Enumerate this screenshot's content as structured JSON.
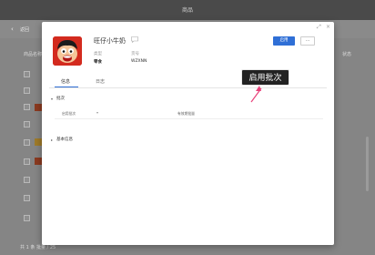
{
  "app": {
    "title": "商品"
  },
  "background": {
    "back_label": "返回",
    "columns": [
      "商品名称",
      "状态"
    ],
    "footer": "共 1 条  批量 / 25"
  },
  "modal": {
    "product": {
      "name": "旺仔小牛奶",
      "type_label": "类型",
      "type_value": "零食",
      "code_label": "货号",
      "code_value": "WZXNN"
    },
    "actions": {
      "enable_label": "启用",
      "more_label": "···"
    },
    "tabs": [
      {
        "label": "信息",
        "active": true
      },
      {
        "label": "日志",
        "active": false
      }
    ],
    "sections": {
      "batch": {
        "title": "批次",
        "field_label": "启用批次",
        "field_selector": "▾",
        "field_value": "有效期批量"
      },
      "basic": {
        "title": "基本信息"
      }
    },
    "window_controls": {
      "expand": "⤢",
      "close": "×"
    }
  },
  "annotation": {
    "text": "启用批次"
  },
  "colors": {
    "accent": "#2f6fd6",
    "arrow": "#e8427a",
    "overlay": "#7d7d7d"
  }
}
